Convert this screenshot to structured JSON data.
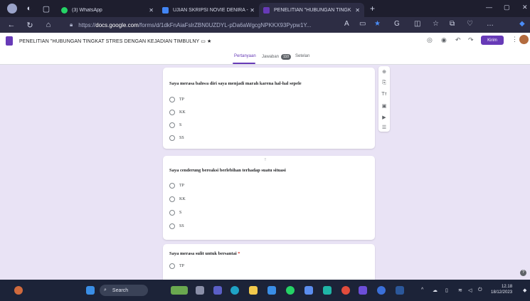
{
  "browser": {
    "tabs": [
      {
        "label": "(3) WhatsApp",
        "fav_color": "#25d366"
      },
      {
        "label": "UJIAN SKRIPSI NOVIE DENIRA - ",
        "fav_color": "#4285f4"
      },
      {
        "label": "PENELITIAN \"HUBUNGAN TINGK",
        "fav_color": "#673ab7"
      }
    ],
    "url_prefix": "https://",
    "url_domain": "docs.google.com",
    "url_path": "/forms/d/1dkFnAiaFslrZBN0UZDYL-pDa6aWgcgNPKKX93Pypw1Y..."
  },
  "form": {
    "title": "PENELITIAN \"HUBUNGAN TINGKAT STRES DENGAN KEJADIAN TIMBULNY",
    "send_label": "Kirim",
    "tabs": {
      "questions": "Pertanyaan",
      "responses": "Jawaban",
      "responses_count": "110",
      "settings": "Setelan"
    },
    "questions": [
      {
        "text": "Saya merasa bahwa diri saya menjadi marah karena hal-hal sepele",
        "options": [
          "TP",
          "KK",
          "S",
          "SS"
        ]
      },
      {
        "text": "Saya cenderung bereaksi berlebihan terhadap suatu situasi",
        "options": [
          "TP",
          "KK",
          "S",
          "SS"
        ]
      },
      {
        "text": "Saya merasa sulit untuk bersantai",
        "options": [
          "TP"
        ]
      }
    ]
  },
  "taskbar": {
    "search_label": "Search",
    "time": "12.18",
    "date": "18/12/2023"
  },
  "colors": {
    "accent": "#673ab7",
    "canvas_bg": "#e9e3f5",
    "taskbar_bg": "#1c2338"
  }
}
